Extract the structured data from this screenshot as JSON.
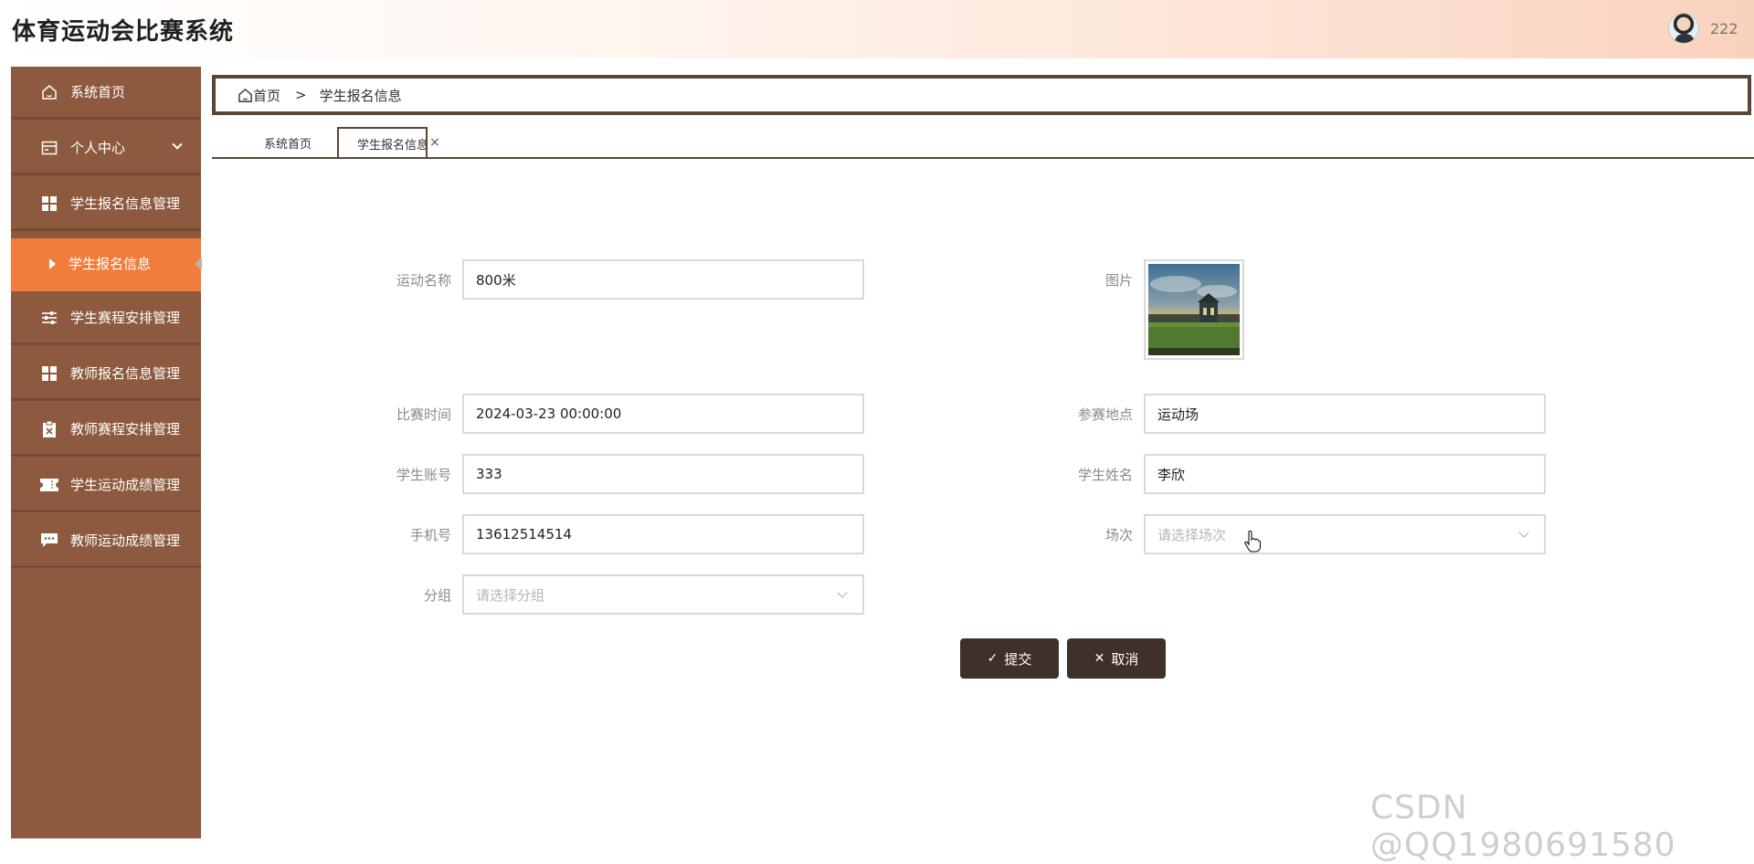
{
  "app": {
    "title": "体育运动会比赛系统",
    "username": "222"
  },
  "sidebar": {
    "items": [
      {
        "label": "系统首页",
        "icon": "home-icon"
      },
      {
        "label": "个人中心",
        "icon": "user-card-icon"
      },
      {
        "label": "学生报名信息管理",
        "icon": "grid-icon"
      },
      {
        "label": "学生报名信息",
        "icon": "caret-right-icon",
        "active": true
      },
      {
        "label": "学生赛程安排管理",
        "icon": "sliders-icon"
      },
      {
        "label": "教师报名信息管理",
        "icon": "grid-icon"
      },
      {
        "label": "教师赛程安排管理",
        "icon": "clipboard-x-icon"
      },
      {
        "label": "学生运动成绩管理",
        "icon": "ticket-icon"
      },
      {
        "label": "教师运动成绩管理",
        "icon": "chat-icon"
      }
    ]
  },
  "breadcrumb": {
    "home": "首页",
    "separator": ">",
    "current": "学生报名信息"
  },
  "tabs": {
    "home": "系统首页",
    "active": "学生报名信息",
    "close": "×"
  },
  "form": {
    "sport_name": {
      "label": "运动名称",
      "value": "800米"
    },
    "picture": {
      "label": "图片"
    },
    "match_time": {
      "label": "比赛时间",
      "value": "2024-03-23 00:00:00"
    },
    "venue": {
      "label": "参赛地点",
      "value": "运动场"
    },
    "student_account": {
      "label": "学生账号",
      "value": "333"
    },
    "student_name": {
      "label": "学生姓名",
      "value": "李欣"
    },
    "phone": {
      "label": "手机号",
      "value": "13612514514"
    },
    "session": {
      "label": "场次",
      "placeholder": "请选择场次"
    },
    "group": {
      "label": "分组",
      "placeholder": "请选择分组"
    }
  },
  "buttons": {
    "submit": "提交",
    "cancel": "取消"
  },
  "watermark": "CSDN @QQ1980691580",
  "colors": {
    "sidebar": "#8d5a3f",
    "active": "#f07d3c",
    "button": "#3f3129",
    "border": "#5b4634"
  }
}
